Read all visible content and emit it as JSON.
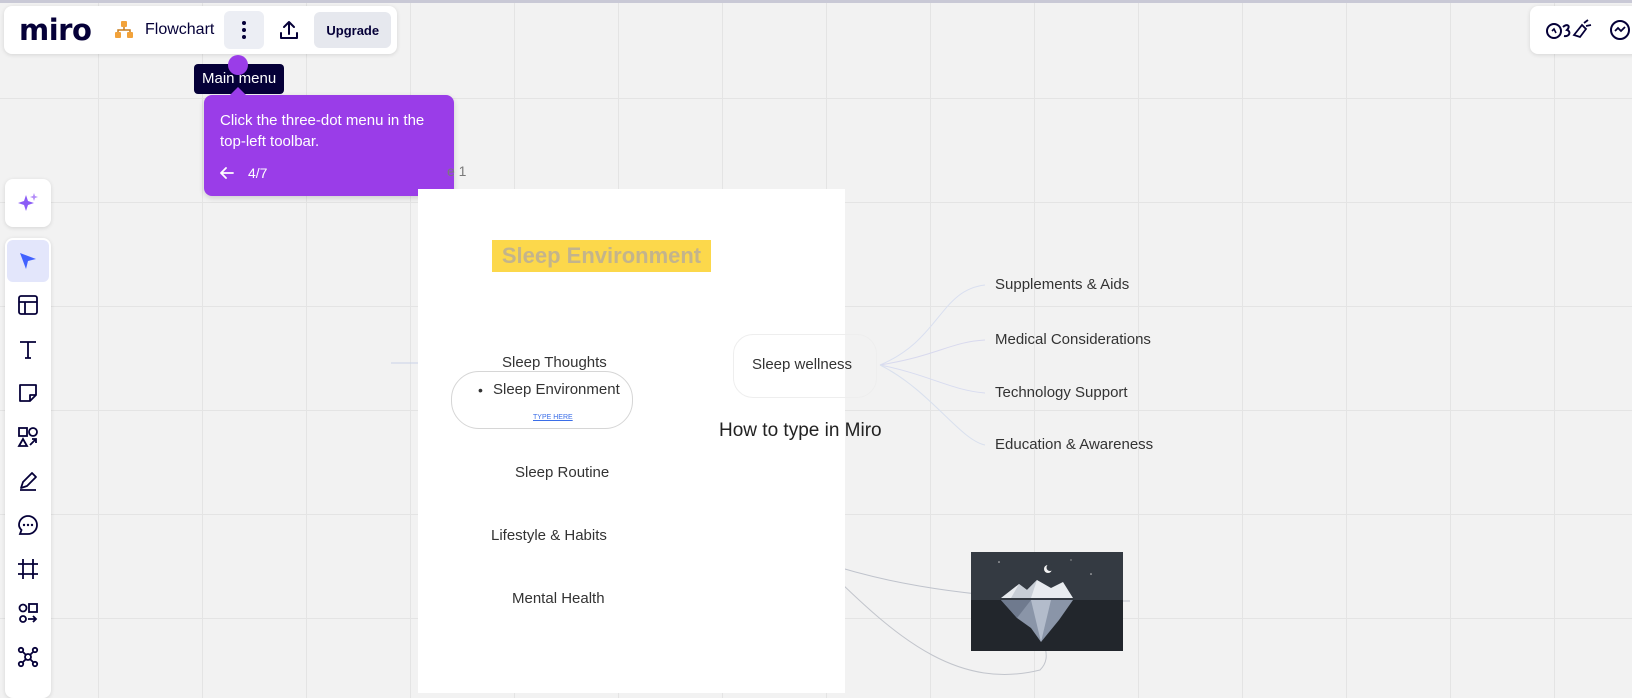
{
  "app": {
    "logo": "miro"
  },
  "topbar": {
    "board_icon": "flowchart-icon",
    "board_name": "Flowchart",
    "menu_icon": "three-dot-icon",
    "share_icon": "upload-icon",
    "upgrade_label": "Upgrade"
  },
  "tooltip": {
    "text": "Main menu"
  },
  "guide": {
    "message": "Click the three-dot menu in the top-left toolbar.",
    "back_icon": "arrow-left-icon",
    "step": "4/7"
  },
  "frame": {
    "label": "e 1"
  },
  "toolbar": {
    "ai_icon": "sparkle-icon",
    "tools": [
      {
        "name": "select",
        "icon": "cursor-icon",
        "active": true
      },
      {
        "name": "templates",
        "icon": "template-icon"
      },
      {
        "name": "text",
        "icon": "text-icon"
      },
      {
        "name": "sticky",
        "icon": "sticky-note-icon"
      },
      {
        "name": "shapes",
        "icon": "shapes-icon"
      },
      {
        "name": "pen",
        "icon": "pen-icon"
      },
      {
        "name": "comment",
        "icon": "comment-icon"
      },
      {
        "name": "frame",
        "icon": "frame-icon"
      },
      {
        "name": "diagram",
        "icon": "diagram-icon"
      },
      {
        "name": "mindmap",
        "icon": "mindmap-icon"
      }
    ]
  },
  "right_panel": {
    "icons": [
      "reactions-icon",
      "chat-icon"
    ]
  },
  "mindmap": {
    "title": "Sleep Environment",
    "left_nodes": {
      "thoughts": "Sleep Thoughts",
      "environment": "Sleep Environment",
      "type_here": "TYPE HERE",
      "routine": "Sleep Routine",
      "lifestyle": "Lifestyle & Habits",
      "mental": "Mental Health"
    },
    "center": "Sleep wellness",
    "right_nodes": {
      "supplements": "Supplements & Aids",
      "medical": "Medical Considerations",
      "technology": "Technology Support",
      "education": "Education & Awareness"
    },
    "how_to": "How to type in Miro"
  },
  "colors": {
    "accent_purple": "#9a3de8",
    "highlight_yellow": "#fcd84b",
    "ink": "#050038"
  }
}
